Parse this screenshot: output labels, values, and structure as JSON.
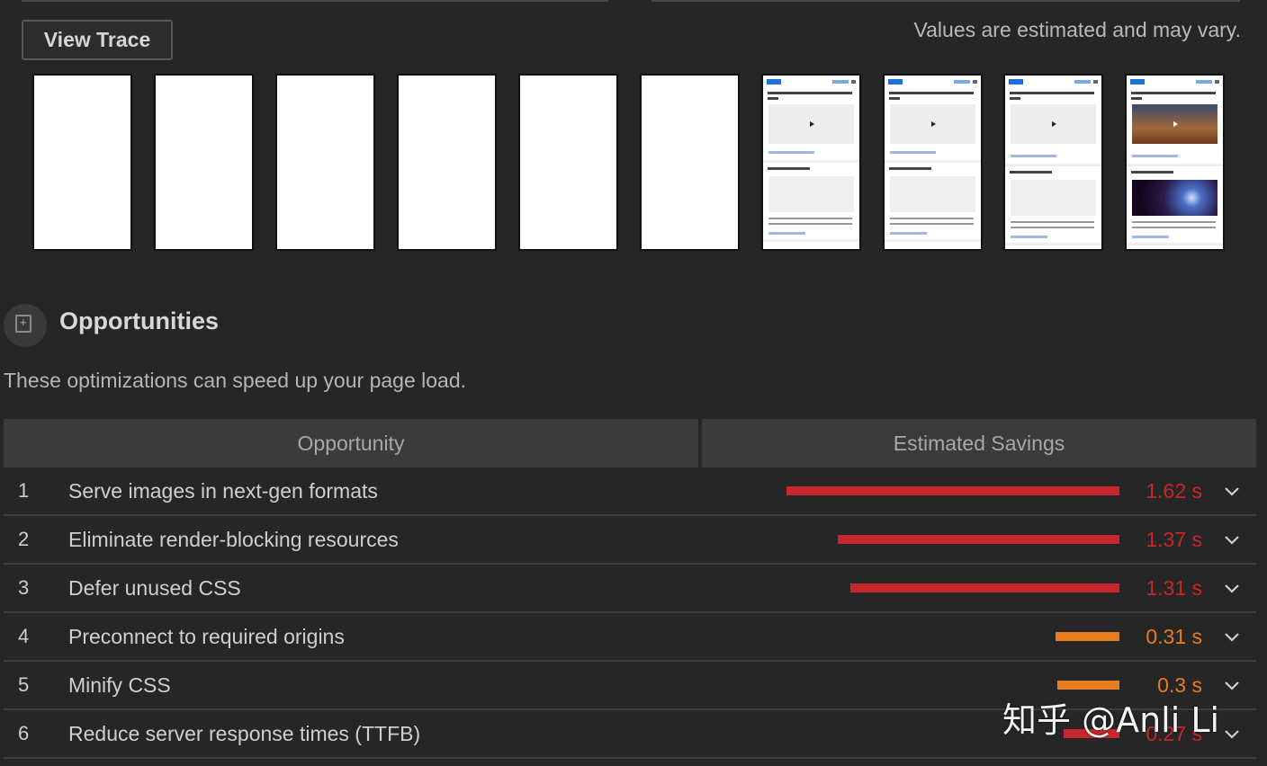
{
  "trace": {
    "view_trace_label": "View Trace",
    "note": "Values are estimated and may vary."
  },
  "filmstrip": {
    "frame_count": 10,
    "frames": [
      {
        "state": "blank"
      },
      {
        "state": "blank"
      },
      {
        "state": "blank"
      },
      {
        "state": "blank"
      },
      {
        "state": "blank"
      },
      {
        "state": "blank"
      },
      {
        "state": "loaded-placeholder"
      },
      {
        "state": "loaded-placeholder"
      },
      {
        "state": "loaded-partial"
      },
      {
        "state": "loaded-full"
      }
    ]
  },
  "opportunities": {
    "title": "Opportunities",
    "description": "These optimizations can speed up your page load.",
    "columns": [
      "Opportunity",
      "Estimated Savings"
    ],
    "items": [
      {
        "num": "1",
        "label": "Serve images in next-gen formats",
        "value": "1.62 s",
        "seconds": 1.62,
        "color": "#c9262b"
      },
      {
        "num": "2",
        "label": "Eliminate render-blocking resources",
        "value": "1.37 s",
        "seconds": 1.37,
        "color": "#c9262b"
      },
      {
        "num": "3",
        "label": "Defer unused CSS",
        "value": "1.31 s",
        "seconds": 1.31,
        "color": "#c9262b"
      },
      {
        "num": "4",
        "label": "Preconnect to required origins",
        "value": "0.31 s",
        "seconds": 0.31,
        "color": "#e67c1e"
      },
      {
        "num": "5",
        "label": "Minify CSS",
        "value": "0.3 s",
        "seconds": 0.3,
        "color": "#e67c1e"
      },
      {
        "num": "6",
        "label": "Reduce server response times (TTFB)",
        "value": "0.27 s",
        "seconds": 0.27,
        "color": "#c9262b"
      }
    ]
  },
  "watermark": "知乎 @Anli Li",
  "colors": {
    "background": "#262626",
    "fail": "#c9262b",
    "average": "#e67c1e"
  }
}
